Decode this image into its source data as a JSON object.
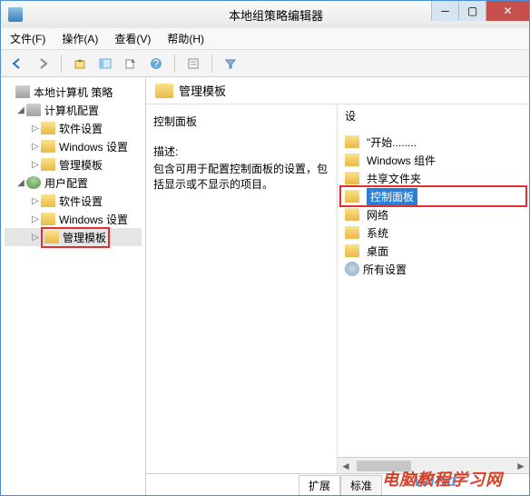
{
  "window": {
    "title": "本地组策略编辑器"
  },
  "menu": {
    "file": "文件(F)",
    "action": "操作(A)",
    "view": "查看(V)",
    "help": "帮助(H)"
  },
  "tree": {
    "root": "本地计算机 策略",
    "computer": "计算机配置",
    "user": "用户配置",
    "soft": "软件设置",
    "win": "Windows 设置",
    "admin": "管理模板"
  },
  "content": {
    "header": "管理模板",
    "left_title": "控制面板",
    "desc_label": "描述:",
    "desc_text": "包含可用于配置控制面板的设置，包括显示或不显示的项目。",
    "col_head": "设",
    "items": [
      "\"开始........",
      "Windows 组件",
      "共享文件夹",
      "控制面板",
      "网络",
      "系统",
      "桌面",
      "所有设置"
    ]
  },
  "tabs": {
    "ext": "扩展",
    "std": "标准"
  },
  "watermark": {
    "a": "Wind",
    "b": "电脑教程学习网"
  }
}
